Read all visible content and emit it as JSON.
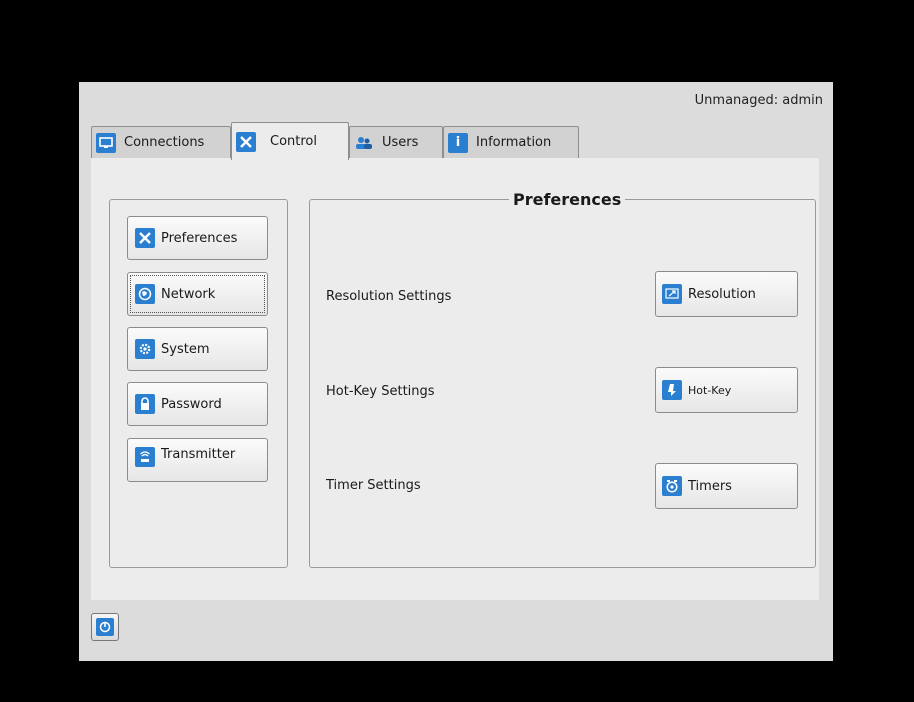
{
  "header": {
    "user_status": "Unmanaged: admin"
  },
  "tabs": [
    {
      "label": "Connections",
      "icon": "monitor-icon"
    },
    {
      "label": "Control",
      "icon": "tools-icon",
      "active": true
    },
    {
      "label": "Users",
      "icon": "users-icon"
    },
    {
      "label": "Information",
      "icon": "info-icon"
    }
  ],
  "sidebar": {
    "items": [
      {
        "label": "Preferences",
        "icon": "tools-icon"
      },
      {
        "label": "Network",
        "icon": "globe-icon",
        "focused": true
      },
      {
        "label": "System",
        "icon": "gear-icon"
      },
      {
        "label": "Password",
        "icon": "lock-icon"
      },
      {
        "label": "Transmitter",
        "icon": "transmitter-icon"
      }
    ]
  },
  "preferences": {
    "title": "Preferences",
    "rows": [
      {
        "label": "Resolution Settings",
        "button": "Resolution",
        "icon": "resolution-icon"
      },
      {
        "label": "Hot-Key Settings",
        "button": "Hot-Key",
        "icon": "hotkey-icon"
      },
      {
        "label": "Timer Settings",
        "button": "Timers",
        "icon": "timer-icon"
      }
    ]
  },
  "footer": {
    "power_icon": "power-icon"
  },
  "colors": {
    "accent": "#2a7fd0",
    "window_bg": "#dcdcdc",
    "panel_bg": "#ececec",
    "outer_bg": "#000000"
  }
}
